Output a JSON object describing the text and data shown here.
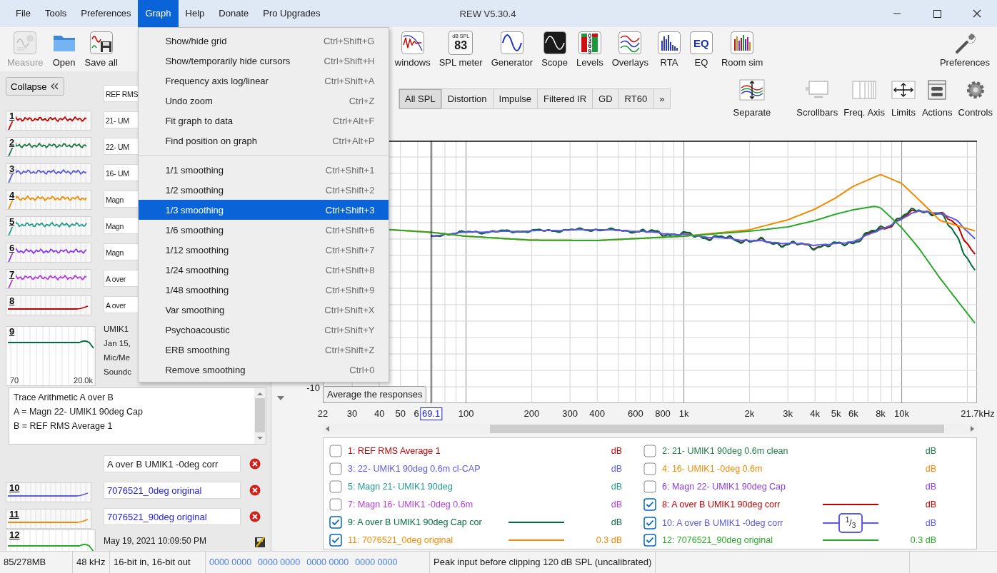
{
  "window": {
    "title": "REW V5.30.4"
  },
  "menu_bar": [
    {
      "label": "File",
      "selected": false
    },
    {
      "label": "Tools",
      "selected": false
    },
    {
      "label": "Preferences",
      "selected": false
    },
    {
      "label": "Graph",
      "selected": true
    },
    {
      "label": "Help",
      "selected": false
    },
    {
      "label": "Donate",
      "selected": false
    },
    {
      "label": "Pro Upgrades",
      "selected": false
    }
  ],
  "graph_menu": {
    "groups": [
      [
        {
          "label": "Show/hide grid",
          "shortcut": "Ctrl+Shift+G",
          "selected": false
        },
        {
          "label": "Show/temporarily hide cursors",
          "shortcut": "Ctrl+Shift+H",
          "selected": false
        },
        {
          "label": "Frequency axis log/linear",
          "shortcut": "Ctrl+Shift+A",
          "selected": false
        },
        {
          "label": "Undo zoom",
          "shortcut": "Ctrl+Z",
          "selected": false
        },
        {
          "label": "Fit graph to data",
          "shortcut": "Ctrl+Alt+F",
          "selected": false
        },
        {
          "label": "Find position on graph",
          "shortcut": "Ctrl+Alt+P",
          "selected": false
        }
      ],
      [
        {
          "label": "1/1 smoothing",
          "shortcut": "Ctrl+Shift+1",
          "selected": false
        },
        {
          "label": "1/2 smoothing",
          "shortcut": "Ctrl+Shift+2",
          "selected": false
        },
        {
          "label": "1/3 smoothing",
          "shortcut": "Ctrl+Shift+3",
          "selected": true
        },
        {
          "label": "1/6 smoothing",
          "shortcut": "Ctrl+Shift+6",
          "selected": false
        },
        {
          "label": "1/12 smoothing",
          "shortcut": "Ctrl+Shift+7",
          "selected": false
        },
        {
          "label": "1/24 smoothing",
          "shortcut": "Ctrl+Shift+8",
          "selected": false
        },
        {
          "label": "1/48 smoothing",
          "shortcut": "Ctrl+Shift+9",
          "selected": false
        },
        {
          "label": "Var smoothing",
          "shortcut": "Ctrl+Shift+X",
          "selected": false
        },
        {
          "label": "Psychoacoustic",
          "shortcut": "Ctrl+Shift+Y",
          "selected": false
        },
        {
          "label": "ERB smoothing",
          "shortcut": "Ctrl+Shift+Z",
          "selected": false
        },
        {
          "label": "Remove smoothing",
          "shortcut": "Ctrl+0",
          "selected": false
        }
      ]
    ]
  },
  "toolbar": [
    {
      "label": "Measure",
      "disabled": true
    },
    {
      "label": "Open",
      "disabled": false
    },
    {
      "label": "Save all",
      "disabled": false
    },
    {
      "label": "windows",
      "disabled": false
    },
    {
      "label": "SPL meter",
      "disabled": false,
      "icon_texts": [
        "dB SPL",
        "83"
      ]
    },
    {
      "label": "Generator",
      "disabled": false
    },
    {
      "label": "Scope",
      "disabled": false
    },
    {
      "label": "Levels",
      "disabled": false,
      "icon_texts": [
        "0369"
      ]
    },
    {
      "label": "Overlays",
      "disabled": false
    },
    {
      "label": "RTA",
      "disabled": false
    },
    {
      "label": "EQ",
      "disabled": false,
      "icon_texts": [
        "EQ"
      ]
    },
    {
      "label": "Room sim",
      "disabled": false
    },
    {
      "label": "Preferences",
      "disabled": false
    }
  ],
  "collapse_button": "Collapse",
  "measurements": [
    {
      "number": "1",
      "name": "REF RMS",
      "color": "#c00000",
      "expanded": false,
      "imported": false
    },
    {
      "number": "2",
      "name": "21- UM",
      "color": "#1e7b45",
      "expanded": false,
      "imported": false
    },
    {
      "number": "3",
      "name": "22- UM",
      "color": "#5a5ae6",
      "expanded": false,
      "imported": false
    },
    {
      "number": "4",
      "name": "16- UM",
      "color": "#f08a00",
      "expanded": false,
      "imported": false
    },
    {
      "number": "5",
      "name": "Magn",
      "color": "#1e9c8c",
      "expanded": false,
      "imported": false
    },
    {
      "number": "6",
      "name": "Magn",
      "color": "#8a3cf0",
      "expanded": false,
      "imported": false
    },
    {
      "number": "7",
      "name": "Magn",
      "color": "#b43cdc",
      "expanded": false,
      "imported": false
    },
    {
      "number": "8",
      "name": "A over",
      "color": "#c00000",
      "expanded": false,
      "imported": false
    },
    {
      "number": "9",
      "name": "A over",
      "color": "#006b3c",
      "expanded": true,
      "imported": false,
      "axis_labels": [
        "70",
        "20.0k"
      ],
      "details": [
        "UMIK1",
        "Jan 15,",
        "Mic/Me",
        "Soundc"
      ],
      "notes": [
        "Trace Arithmetic A over B",
        "A = Magn 22- UMIK1 90deg Cap",
        "B = REF RMS Average 1"
      ]
    },
    {
      "number": "10",
      "name": "A over B UMIK1 -0deg corr",
      "color": "#5a5ae6",
      "expanded": false,
      "imported": false
    },
    {
      "number": "11",
      "name": "7076521_0deg original",
      "color": "#f08a00",
      "expanded": false,
      "imported": true
    },
    {
      "number": "12",
      "name": "7076521_90deg original",
      "color": "#28a828",
      "expanded": true,
      "imported": true,
      "details": [
        "May 19, 2021 10:09:50 PM"
      ]
    }
  ],
  "graph_tabs": [
    {
      "label": "All SPL",
      "selected": true
    },
    {
      "label": "Distortion",
      "selected": false
    },
    {
      "label": "Impulse",
      "selected": false
    },
    {
      "label": "Filtered IR",
      "selected": false
    },
    {
      "label": "GD",
      "selected": false
    },
    {
      "label": "RT60",
      "selected": false
    },
    {
      "label": "»",
      "selected": false
    }
  ],
  "graph_tools": [
    {
      "label": "Separate"
    },
    {
      "label": "Scrollbars"
    },
    {
      "label": "Freq. Axis"
    },
    {
      "label": "Limits"
    },
    {
      "label": "Actions"
    },
    {
      "label": "Controls"
    }
  ],
  "graph": {
    "y_label": "-10",
    "x_labels": [
      "22",
      "30",
      "40",
      "50",
      "6",
      "100",
      "200",
      "300",
      "400",
      "600",
      "800",
      "1k",
      "2k",
      "3k",
      "4k",
      "5k",
      "6k",
      "8k",
      "10k",
      "21.7kHz"
    ],
    "cursor_readout": "69.1",
    "tooltip": "Average the responses"
  },
  "legend": [
    {
      "label": "1: REF RMS Average 1",
      "value": "dB",
      "color": "#c00000",
      "checked": false,
      "kind": "plain"
    },
    {
      "label": "2: 21- UMIK1 90deg 0.6m clean",
      "value": "dB",
      "color": "#1e7b45",
      "checked": false,
      "kind": "plain"
    },
    {
      "label": "3: 22- UMIK1 90deg 0.6m cl-CAP",
      "value": "dB",
      "color": "#5a5ae6",
      "checked": false,
      "kind": "plain"
    },
    {
      "label": "4: 16- UMIK1 -0deg 0.6m",
      "value": "dB",
      "color": "#f08a00",
      "checked": false,
      "kind": "plain"
    },
    {
      "label": "5: Magn 21- UMIK1 90deg",
      "value": "dB",
      "color": "#1e9c8c",
      "checked": false,
      "kind": "plain"
    },
    {
      "label": "6: Magn 22- UMIK1 90deg Cap",
      "value": "dB",
      "color": "#8a3cf0",
      "checked": false,
      "kind": "plain"
    },
    {
      "label": "7: Magn 16- UMIK1 -0deg 0.6m",
      "value": "dB",
      "color": "#b43cdc",
      "checked": false,
      "kind": "plain"
    },
    {
      "label": "8: A over B UMIK1 90deg corr",
      "value": "dB",
      "color": "#c00000",
      "checked": true,
      "kind": "line"
    },
    {
      "label": "9: A over B UMIK1 90deg Cap cor",
      "value": "dB",
      "color": "#006b3c",
      "checked": true,
      "kind": "line"
    },
    {
      "label": "10: A over B UMIK1 -0deg corr",
      "value": "dB",
      "color": "#5a5ae6",
      "checked": true,
      "kind": "smoothing",
      "badge": "$^{1}$/$_{3}$"
    },
    {
      "label": "11: 7076521_0deg original",
      "value": "0.3 dB",
      "color": "#f08a00",
      "checked": true,
      "kind": "line"
    },
    {
      "label": "12: 7076521_90deg original",
      "value": "0.3 dB",
      "color": "#28a828",
      "checked": true,
      "kind": "line"
    }
  ],
  "status_bar": {
    "memory": "85/278MB",
    "sample_rate": "48 kHz",
    "bit_depth": "16-bit in, 16-bit out",
    "levels": [
      "0000 0000",
      "0000 0000",
      "0000 0000",
      "0000 0000"
    ],
    "message": "Peak input before clipping 120 dB SPL (uncalibrated)"
  }
}
